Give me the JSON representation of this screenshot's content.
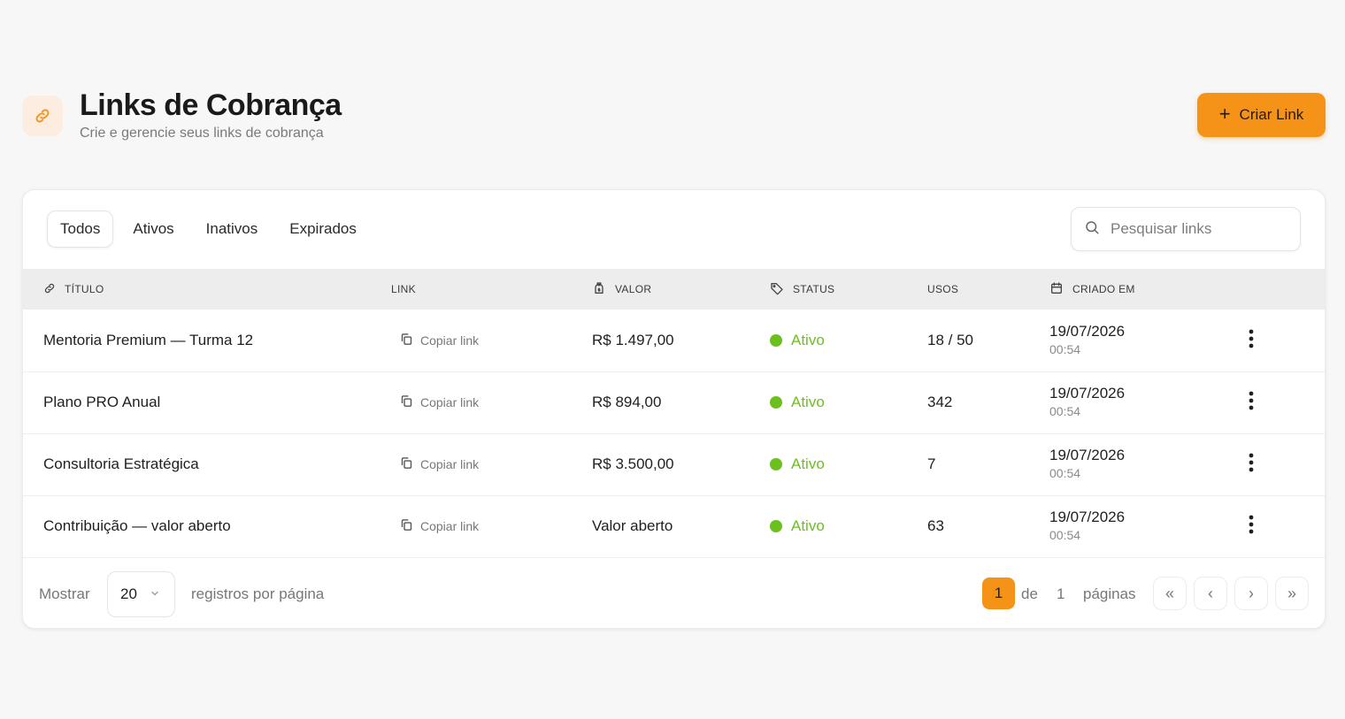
{
  "header": {
    "title": "Links de Cobrança",
    "subtitle": "Crie e gerencie seus links de cobrança",
    "create_button": "Criar Link",
    "icon": "link-icon"
  },
  "tabs": [
    {
      "label": "Todos",
      "active": true
    },
    {
      "label": "Ativos",
      "active": false
    },
    {
      "label": "Inativos",
      "active": false
    },
    {
      "label": "Expirados",
      "active": false
    }
  ],
  "search": {
    "placeholder": "Pesquisar links",
    "value": ""
  },
  "table": {
    "columns": {
      "title": "TÍTULO",
      "link": "LINK",
      "value": "VALOR",
      "status": "STATUS",
      "uses": "USOS",
      "created": "CRIADO EM"
    },
    "rows": [
      {
        "title": "Mentoria Premium — Turma 12",
        "link_action": "Copiar link",
        "value": "R$ 1.497,00",
        "status": "Ativo",
        "uses": "18 / 50",
        "date": "19/07/2026",
        "time": "00:54"
      },
      {
        "title": "Plano PRO Anual",
        "link_action": "Copiar link",
        "value": "R$ 894,00",
        "status": "Ativo",
        "uses": "342",
        "date": "19/07/2026",
        "time": "00:54"
      },
      {
        "title": "Consultoria Estratégica",
        "link_action": "Copiar link",
        "value": "R$ 3.500,00",
        "status": "Ativo",
        "uses": "7",
        "date": "19/07/2026",
        "time": "00:54"
      },
      {
        "title": "Contribuição — valor aberto",
        "link_action": "Copiar link",
        "value": "Valor aberto",
        "status": "Ativo",
        "uses": "63",
        "date": "19/07/2026",
        "time": "00:54"
      }
    ]
  },
  "footer": {
    "show_label": "Mostrar",
    "page_size": "20",
    "per_page_label": "registros por página",
    "current_page": "1",
    "of_label": "de",
    "total_pages": "1",
    "pages_label": "páginas",
    "first": "«",
    "prev": "‹",
    "next": "›",
    "last": "»"
  },
  "colors": {
    "accent": "#f59218",
    "status_active": "#6cc01e",
    "background": "#f7f7f7"
  }
}
